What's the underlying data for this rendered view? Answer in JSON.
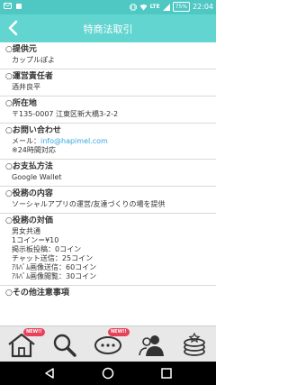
{
  "status_bar": {
    "network": "LTE",
    "battery": "75%",
    "time": "22:04"
  },
  "header": {
    "title": "特商法取引"
  },
  "sections": [
    {
      "heading": "○提供元",
      "lines": [
        "カップルぽよ"
      ]
    },
    {
      "heading": "○運営責任者",
      "lines": [
        "酒井良平"
      ]
    },
    {
      "heading": "○所在地",
      "lines": [
        "〒135-0007 江東区新大橋3-2-2"
      ]
    },
    {
      "heading": "○お問い合わせ",
      "lines": [
        "メール：",
        "※24時間対応"
      ],
      "email": "info@hapimel.com"
    },
    {
      "heading": "○お支払方法",
      "lines": [
        "Google Wallet"
      ]
    },
    {
      "heading": "○役務の内容",
      "lines": [
        "ソーシャルアプリの運営/友達づくりの場を提供"
      ]
    },
    {
      "heading": "○役務の対価",
      "lines": [
        "男女共通",
        "1コイン＝¥10",
        "掲示板投稿：0コイン",
        "チャット送信：25コイン",
        "ｱﾙﾊﾞﾑ画像送信：60コイン",
        "ｱﾙﾊﾞﾑ画像閲覧：30コイン"
      ]
    },
    {
      "heading": "○その他注意事項",
      "lines": []
    }
  ],
  "tabbar": {
    "badge_new": "NEW!!",
    "tabs": [
      "home",
      "search",
      "chat",
      "users",
      "coins"
    ]
  },
  "colors": {
    "status_bar": "#4fc8c4",
    "header": "#62d5d0",
    "link": "#35a7e0",
    "badge": "#e8425a"
  }
}
